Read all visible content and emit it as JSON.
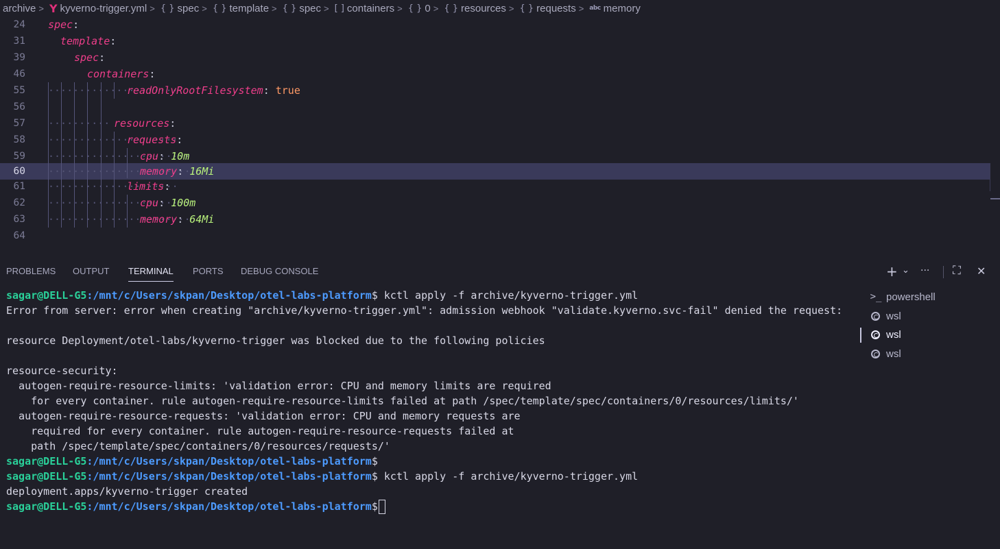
{
  "breadcrumb": {
    "items": [
      {
        "icon": "",
        "label": "archive"
      },
      {
        "icon": "yaml-icon",
        "label": "kyverno-trigger.yml"
      },
      {
        "icon": "object-icon",
        "label": "spec"
      },
      {
        "icon": "object-icon",
        "label": "template"
      },
      {
        "icon": "object-icon",
        "label": "spec"
      },
      {
        "icon": "array-icon",
        "label": "containers"
      },
      {
        "icon": "object-icon",
        "label": "0"
      },
      {
        "icon": "object-icon",
        "label": "resources"
      },
      {
        "icon": "object-icon",
        "label": "requests"
      },
      {
        "icon": "string-icon",
        "label": "memory"
      }
    ]
  },
  "editor": {
    "lines": [
      {
        "num": "24",
        "key": "spec",
        "value": ""
      },
      {
        "num": "31",
        "key": "template",
        "value": ""
      },
      {
        "num": "39",
        "key": "spec",
        "value": ""
      },
      {
        "num": "46",
        "key": "containers",
        "value": ""
      },
      {
        "num": "55",
        "key": "readOnlyRootFilesystem",
        "value": "true"
      },
      {
        "num": "56",
        "key": "",
        "value": ""
      },
      {
        "num": "57",
        "key": "resources",
        "value": ""
      },
      {
        "num": "58",
        "key": "requests",
        "value": ""
      },
      {
        "num": "59",
        "key": "cpu",
        "value": "10m"
      },
      {
        "num": "60",
        "key": "memory",
        "value": "16Mi"
      },
      {
        "num": "61",
        "key": "limits",
        "value": ""
      },
      {
        "num": "62",
        "key": "cpu",
        "value": "100m"
      },
      {
        "num": "63",
        "key": "memory",
        "value": "64Mi"
      },
      {
        "num": "64",
        "key": "",
        "value": ""
      }
    ],
    "current_line": "60"
  },
  "panel": {
    "tabs": [
      "PROBLEMS",
      "OUTPUT",
      "TERMINAL",
      "PORTS",
      "DEBUG CONSOLE"
    ],
    "active_tab": "TERMINAL",
    "buttons": {
      "add": "+",
      "dropdown": "⌄",
      "more": "···",
      "maximize": "⛶",
      "close": "✕"
    }
  },
  "terminal": {
    "prompt_user": "sagar@DELL-G5",
    "prompt_path": ":/mnt/c/Users/skpan/Desktop/otel-labs-platform",
    "prompt_symbol": "$",
    "command": " kctl apply -f archive/kyverno-trigger.yml",
    "output_1": "Error from server: error when creating \"archive/kyverno-trigger.yml\": admission webhook \"validate.kyverno.svc-fail\" denied the request:",
    "output_2": "resource Deployment/otel-labs/kyverno-trigger was blocked due to the following policies",
    "output_3": "resource-security:",
    "output_4": "  autogen-require-resource-limits: 'validation error: CPU and memory limits are required",
    "output_5": "    for every container. rule autogen-require-resource-limits failed at path /spec/template/spec/containers/0/resources/limits/'",
    "output_6": "  autogen-require-resource-requests: 'validation error: CPU and memory requests are",
    "output_7": "    required for every container. rule autogen-require-resource-requests failed at",
    "output_8": "    path /spec/template/spec/containers/0/resources/requests/'",
    "output_9": "deployment.apps/kyverno-trigger created"
  },
  "terminal_list": [
    {
      "icon": "terminal-icon",
      "label": "powershell",
      "active": false
    },
    {
      "icon": "debian-icon",
      "label": "wsl",
      "active": false
    },
    {
      "icon": "debian-icon",
      "label": "wsl",
      "active": true
    },
    {
      "icon": "debian-icon",
      "label": "wsl",
      "active": false
    }
  ]
}
